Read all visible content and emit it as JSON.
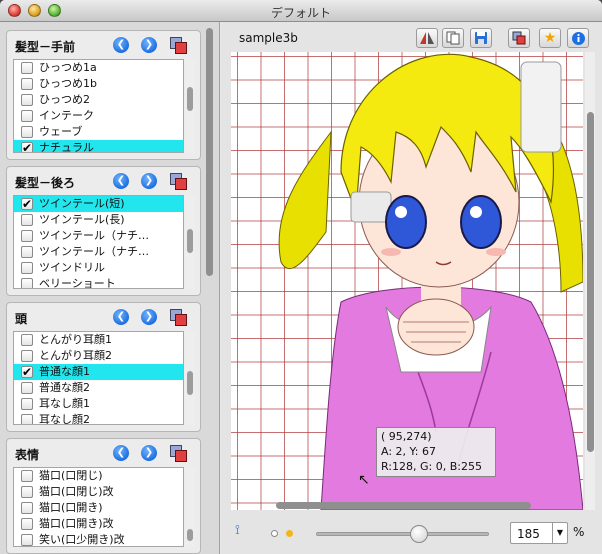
{
  "window": {
    "title": "デフォルト"
  },
  "panels": [
    {
      "title": "髪型－手前",
      "items": [
        {
          "label": "ひっつめ1a",
          "checked": false,
          "selected": false
        },
        {
          "label": "ひっつめ1b",
          "checked": false,
          "selected": false
        },
        {
          "label": "ひっつめ2",
          "checked": false,
          "selected": false
        },
        {
          "label": "インテーク",
          "checked": false,
          "selected": false
        },
        {
          "label": "ウェーブ",
          "checked": false,
          "selected": false
        },
        {
          "label": "ナチュラル",
          "checked": true,
          "selected": true
        }
      ]
    },
    {
      "title": "髪型－後ろ",
      "items": [
        {
          "label": "ツインテール(短)",
          "checked": true,
          "selected": true
        },
        {
          "label": "ツインテール(長)",
          "checked": false,
          "selected": false
        },
        {
          "label": "ツインテール（ナチ…",
          "checked": false,
          "selected": false
        },
        {
          "label": "ツインテール（ナチ…",
          "checked": false,
          "selected": false
        },
        {
          "label": "ツインドリル",
          "checked": false,
          "selected": false
        },
        {
          "label": "ベリーショート",
          "checked": false,
          "selected": false
        }
      ]
    },
    {
      "title": "頭",
      "items": [
        {
          "label": "とんがり耳顔1",
          "checked": false,
          "selected": false
        },
        {
          "label": "とんがり耳顔2",
          "checked": false,
          "selected": false
        },
        {
          "label": "普通な顔1",
          "checked": true,
          "selected": true
        },
        {
          "label": "普通な顔2",
          "checked": false,
          "selected": false
        },
        {
          "label": "耳なし顔1",
          "checked": false,
          "selected": false
        },
        {
          "label": "耳なし顔2",
          "checked": false,
          "selected": false
        }
      ]
    },
    {
      "title": "表情",
      "items": [
        {
          "label": "猫口(口閉じ)",
          "checked": false,
          "selected": false
        },
        {
          "label": "猫口(口閉じ)改",
          "checked": false,
          "selected": false
        },
        {
          "label": "猫口(口開き)",
          "checked": false,
          "selected": false
        },
        {
          "label": "猫口(口開き)改",
          "checked": false,
          "selected": false
        },
        {
          "label": "笑い(口少開き)改",
          "checked": false,
          "selected": false
        }
      ]
    }
  ],
  "canvas": {
    "doc_name": "sample3b",
    "tooltip": {
      "line1": "( 95,274)",
      "line2": "A:  2, Y: 67",
      "line3": "R:128, G:  0, B:255"
    }
  },
  "toolbar": {
    "icons": [
      "flip-icon",
      "copy-icon",
      "save-icon",
      "layers-icon",
      "favorite-icon",
      "info-icon"
    ]
  },
  "bottom": {
    "zoom_value": "185",
    "zoom_unit": "%"
  },
  "colors": {
    "selection": "#22e6ee",
    "grid": "#b04040",
    "accent": "#1e6fe0"
  }
}
